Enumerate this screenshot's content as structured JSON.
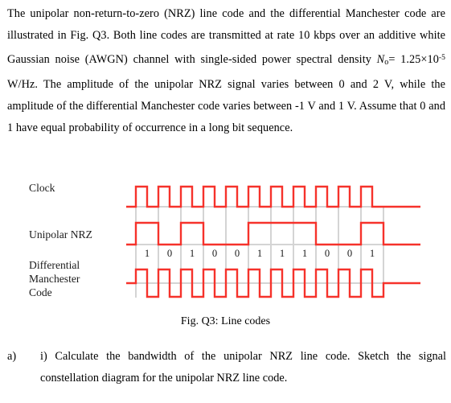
{
  "document": {
    "intro": {
      "line1": "The unipolar non-return-to-zero (NRZ) line code and the differential Manchester",
      "line2": "code are illustrated in Fig. Q3. Both line codes are transmitted at rate 10 kbps over",
      "line3": "an additive white Gaussian noise (AWGN) channel with single-sided power",
      "line4_a": "spectral density ",
      "line4_sym": "N",
      "line4_sub": "o",
      "line4_b": "= 1.25×10",
      "line4_sup": "-5",
      "line4_c": " W/Hz. The amplitude of the unipolar NRZ signal",
      "line5": "varies between 0 and 2 V, while the amplitude of the differential Manchester code",
      "line6": "varies between -1 V and 1 V. Assume that 0 and 1 have equal probability of",
      "line7": "occurrence in a long bit sequence."
    },
    "figure": {
      "labels": {
        "clock": "Clock",
        "unipolar_nrz": "Unipolar NRZ",
        "dmc_line1": "Differential",
        "dmc_line2": "Manchester",
        "dmc_line3": "Code"
      },
      "caption": "Fig. Q3: Line codes",
      "colors": {
        "waveform": "#f6322b",
        "gridline": "#c9c9c9",
        "baseline": "#d4d4d4"
      }
    },
    "question": {
      "marker": "a)",
      "text": "i) Calculate the bandwidth of the unipolar NRZ line code. Sketch the signal constellation diagram for the unipolar NRZ line code."
    }
  },
  "chart_data": {
    "type": "line",
    "title": "Fig. Q3: Line codes",
    "xlabel": "",
    "ylabel": "",
    "bit_sequence": [
      1,
      0,
      1,
      0,
      0,
      1,
      1,
      1,
      0,
      0,
      1
    ],
    "bit_labels": [
      "1",
      "0",
      "1",
      "0",
      "0",
      "1",
      "1",
      "1",
      "0",
      "0",
      "1"
    ],
    "bit_count": 11,
    "geometry": {
      "x_start": 169,
      "bit_width": 28.0,
      "tail_left": 12,
      "tail_right": 46,
      "clock_baseline_y": 53,
      "clock_high_y": 28,
      "nrz_baseline_y": 100,
      "nrz_high_y": 73,
      "dmc_zero_y": 148,
      "dmc_high_y": 131,
      "dmc_low_y": 165,
      "grid_top_y": 53,
      "grid_bottom_y": 166
    },
    "series": [
      {
        "name": "Clock",
        "description": "Square wave, one full period per bit interval; high during first half of each bit, low during second half.",
        "levels": [
          "low",
          "high"
        ],
        "periods": 11
      },
      {
        "name": "Unipolar NRZ",
        "description": "Level high (2 V) for bit 1 and low (0 V) for bit 0, held for the whole bit interval.",
        "levels_per_bit": [
          1,
          0,
          1,
          0,
          0,
          1,
          1,
          1,
          0,
          0,
          1
        ],
        "amplitude_volts": [
          0,
          2
        ]
      },
      {
        "name": "Differential Manchester Code",
        "description": "Always a mid-bit transition; additional transition at the start of the bit interval when the bit is 0.",
        "half_bit_levels": [
          1,
          -1,
          1,
          -1,
          1,
          -1,
          1,
          -1,
          1,
          -1,
          1,
          -1,
          1,
          -1,
          1,
          -1,
          1,
          -1,
          1,
          -1,
          1,
          -1
        ],
        "amplitude_volts": [
          -1,
          1
        ]
      }
    ]
  }
}
